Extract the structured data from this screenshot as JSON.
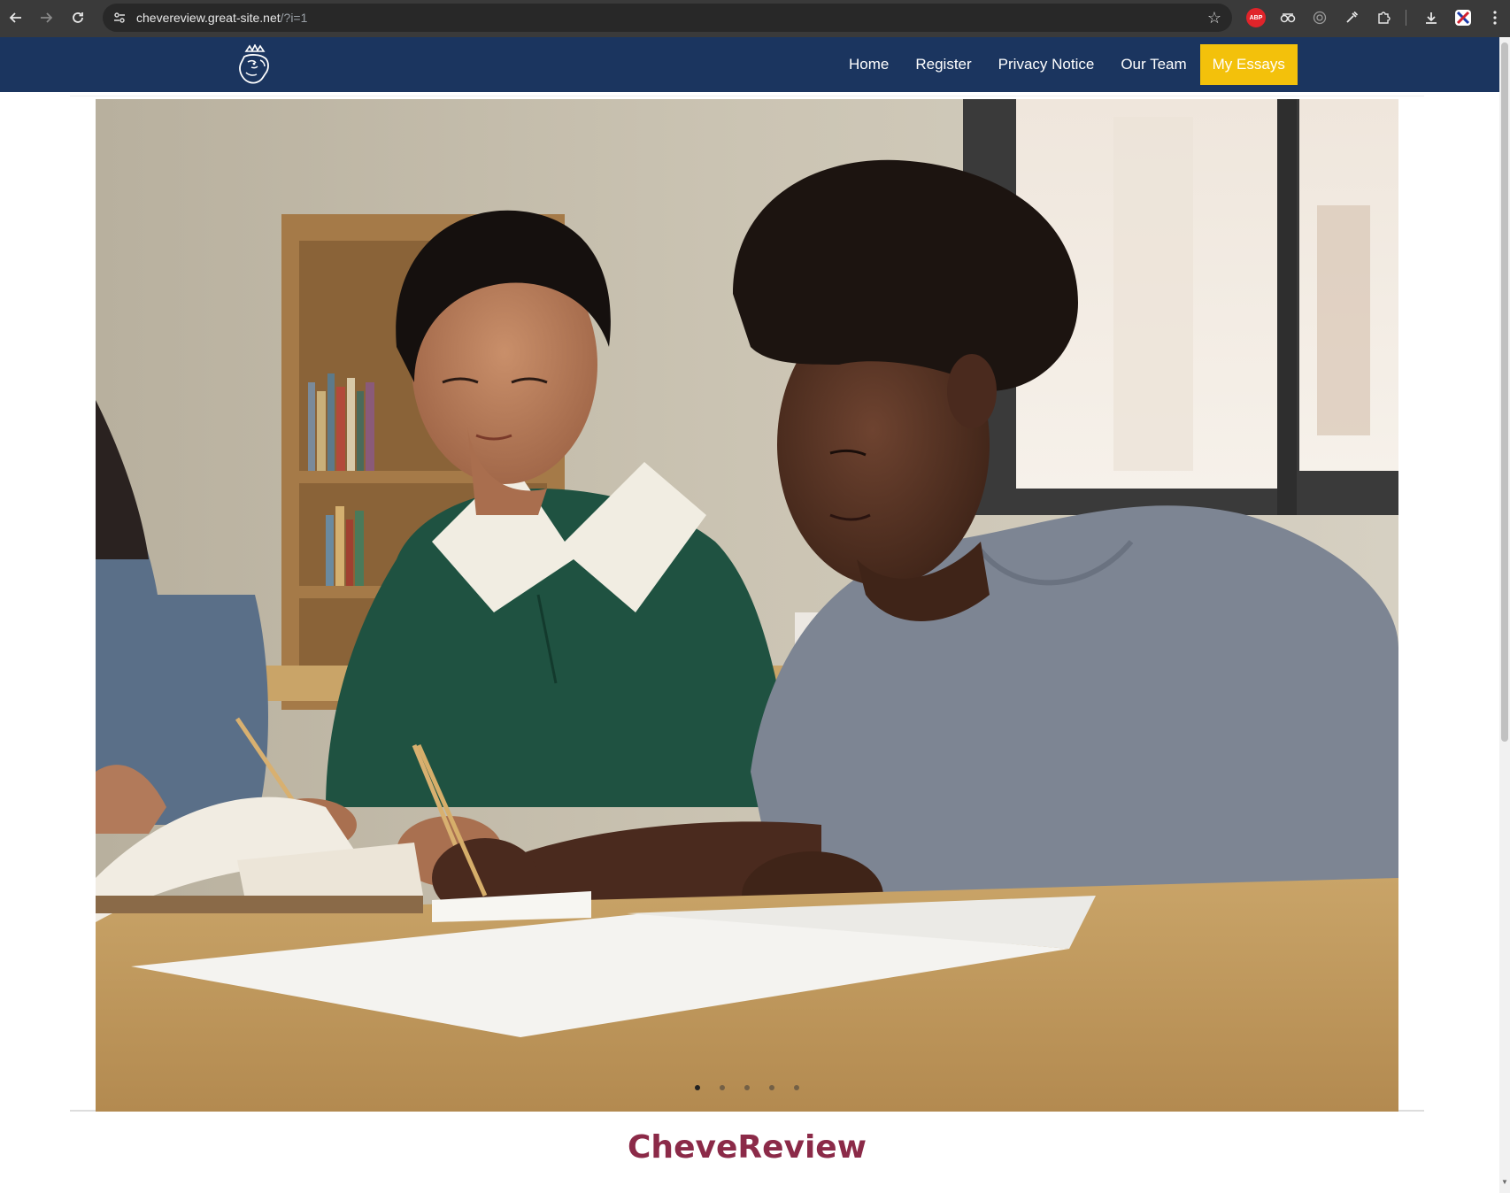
{
  "browser": {
    "url_host": "chevereview.great-site.net",
    "url_path": "/?i=1",
    "icons": [
      "back-icon",
      "forward-icon",
      "reload-icon",
      "site-info-icon",
      "bookmark-star-icon",
      "adblock-icon",
      "spy-glasses-icon",
      "circle-extension-icon",
      "eyedropper-icon",
      "puzzle-icon",
      "download-icon",
      "profile-icon",
      "menu-icon"
    ],
    "abp_label": "ABP"
  },
  "site": {
    "brand_color": "#1b355f",
    "cta_color": "#f3c10b",
    "title_color": "#8b2a48",
    "nav": [
      {
        "label": "Home"
      },
      {
        "label": "Register"
      },
      {
        "label": "Privacy Notice"
      },
      {
        "label": "Our Team"
      }
    ],
    "cta_label": "My Essays",
    "title": "CheveReview"
  },
  "slider": {
    "slide_count": 5,
    "active_index": 0,
    "image_subject": "two students writing at a classroom desk"
  }
}
